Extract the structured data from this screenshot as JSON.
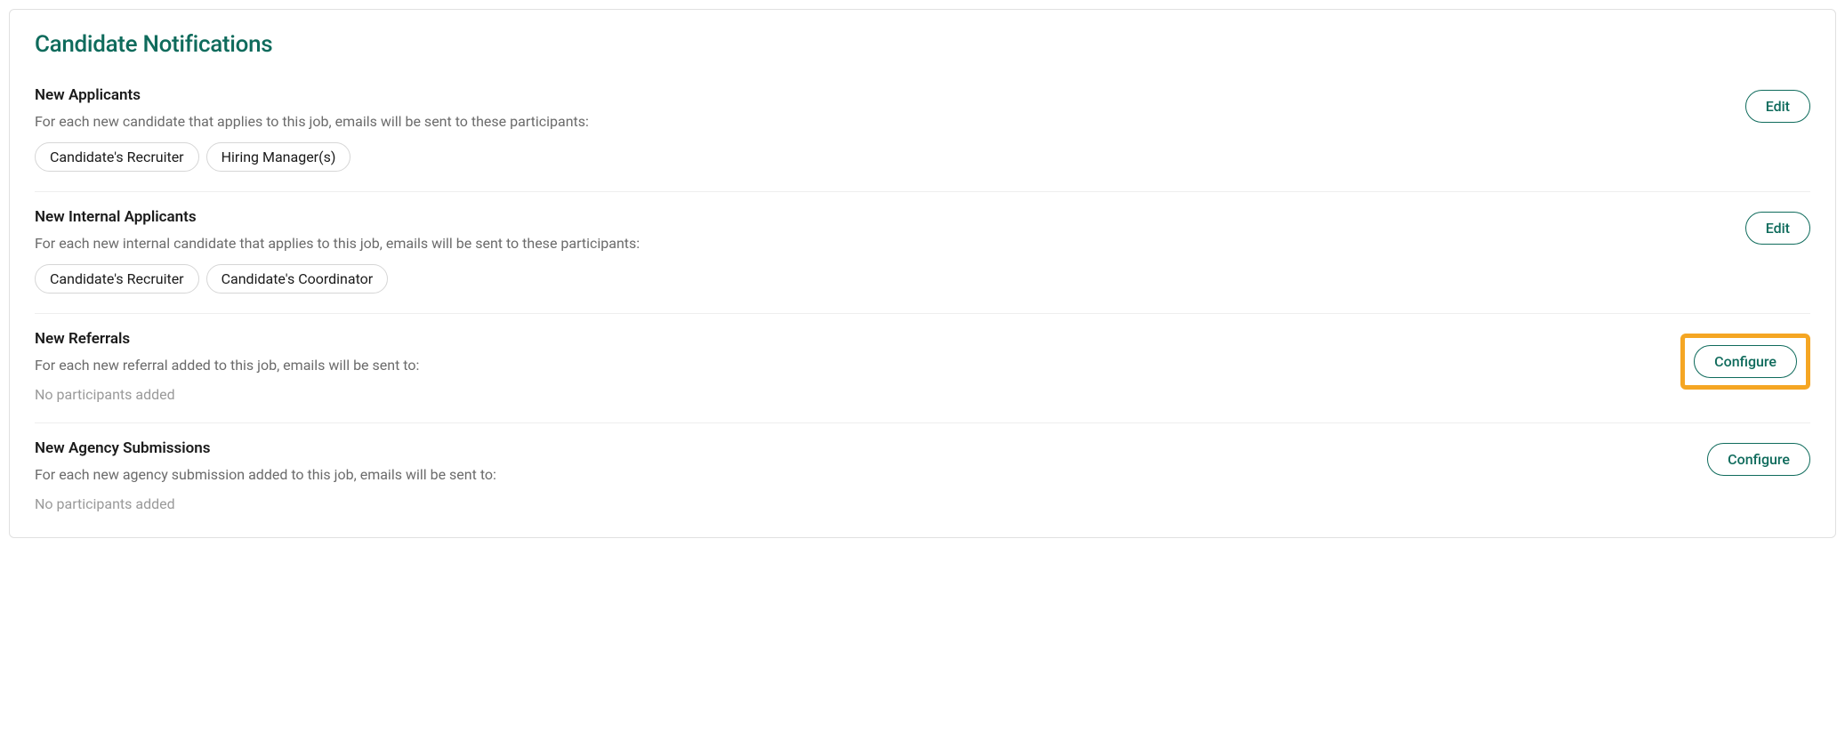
{
  "card": {
    "title": "Candidate Notifications"
  },
  "sections": {
    "new_applicants": {
      "title": "New Applicants",
      "description": "For each new candidate that applies to this job, emails will be sent to these participants:",
      "chips": {
        "0": "Candidate's Recruiter",
        "1": "Hiring Manager(s)"
      },
      "action_label": "Edit"
    },
    "new_internal_applicants": {
      "title": "New Internal Applicants",
      "description": "For each new internal candidate that applies to this job, emails will be sent to these participants:",
      "chips": {
        "0": "Candidate's Recruiter",
        "1": "Candidate's Coordinator"
      },
      "action_label": "Edit"
    },
    "new_referrals": {
      "title": "New Referrals",
      "description": "For each new referral added to this job, emails will be sent to:",
      "empty_text": "No participants added",
      "action_label": "Configure"
    },
    "new_agency_submissions": {
      "title": "New Agency Submissions",
      "description": "For each new agency submission added to this job, emails will be sent to:",
      "empty_text": "No participants added",
      "action_label": "Configure"
    }
  }
}
